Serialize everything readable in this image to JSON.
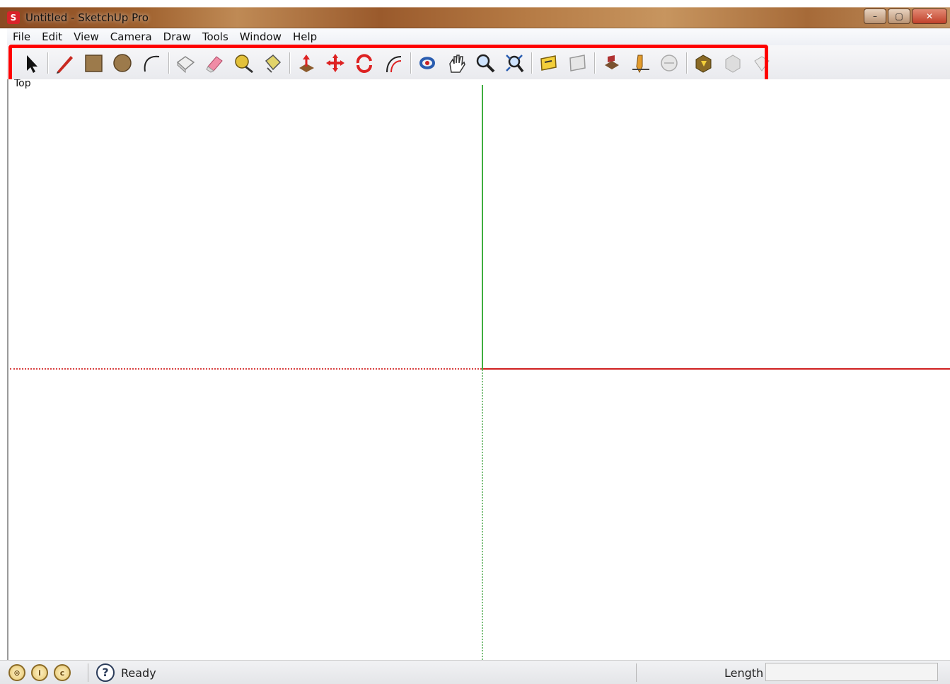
{
  "window": {
    "title": "Untitled - SketchUp Pro",
    "controls": {
      "minimize": "–",
      "maximize": "▢",
      "close": "✕"
    }
  },
  "menu": [
    "File",
    "Edit",
    "View",
    "Camera",
    "Draw",
    "Tools",
    "Window",
    "Help"
  ],
  "toolbar": {
    "tools": [
      "select-icon",
      "|",
      "pencil-line-icon",
      "rectangle-icon",
      "circle-icon",
      "arc-icon",
      "|",
      "make-component-icon",
      "eraser-icon",
      "tape-measure-icon",
      "paint-bucket-icon",
      "|",
      "push-pull-icon",
      "move-icon",
      "rotate-icon",
      "offset-icon",
      "|",
      "orbit-icon",
      "pan-icon",
      "zoom-icon",
      "zoom-extents-icon",
      "|",
      "3d-warehouse-icon",
      "share-model-icon",
      "|",
      "photo-textures-icon",
      "preview-model-icon",
      "get-models-icon",
      "|",
      "extension-warehouse-icon",
      "layout-icon",
      "style-builder-icon"
    ],
    "highlight_color": "#ff0000"
  },
  "viewport": {
    "view_label": "Top",
    "axes": {
      "green": "#3fae3f",
      "red": "#d02020"
    }
  },
  "status": {
    "icons": [
      "geo-location-icon",
      "credits-icon",
      "copyright-icon"
    ],
    "help_symbol": "?",
    "text": "Ready",
    "length_label": "Length",
    "length_value": ""
  }
}
